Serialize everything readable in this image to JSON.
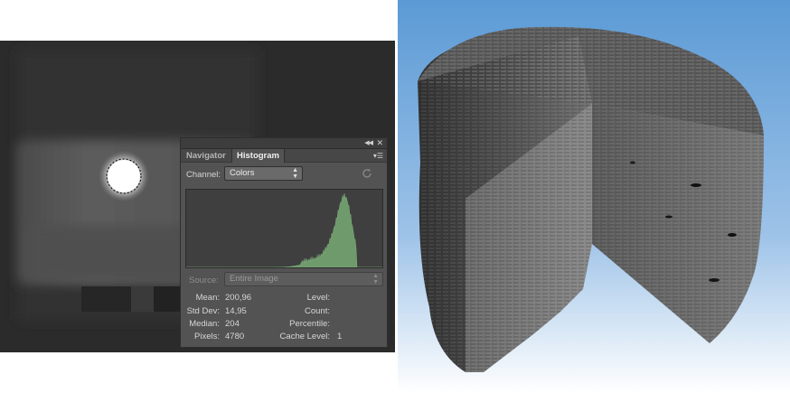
{
  "panel": {
    "tabs": [
      "Navigator",
      "Histogram"
    ],
    "channel_label": "Channel:",
    "channel_value": "Colors",
    "source_label": "Source:",
    "source_value": "Entire Image",
    "histogram_color": "#6e9a6c"
  },
  "stats": {
    "mean_label": "Mean:",
    "mean_value": "200,96",
    "stddev_label": "Std Dev:",
    "stddev_value": "14,95",
    "median_label": "Median:",
    "median_value": "204",
    "pixels_label": "Pixels:",
    "pixels_value": "4780",
    "level_label": "Level:",
    "level_value": "",
    "count_label": "Count:",
    "count_value": "",
    "percentile_label": "Percentile:",
    "percentile_value": "",
    "cache_label": "Cache Level:",
    "cache_value": "1"
  }
}
